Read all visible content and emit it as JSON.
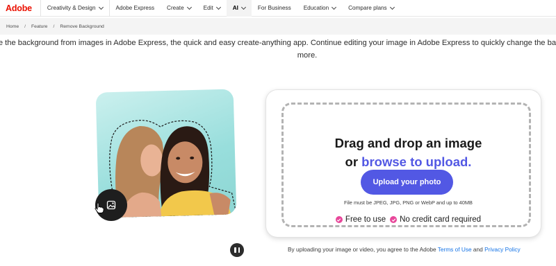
{
  "nav": {
    "brand": "Adobe",
    "items": [
      {
        "label": "Creativity & Design",
        "dropdown": true
      },
      {
        "label": "Adobe Express",
        "dropdown": false
      },
      {
        "label": "Create",
        "dropdown": true
      },
      {
        "label": "Edit",
        "dropdown": true
      },
      {
        "label": "AI",
        "dropdown": true,
        "active": true
      },
      {
        "label": "For Business",
        "dropdown": false
      },
      {
        "label": "Education",
        "dropdown": true
      },
      {
        "label": "Compare plans",
        "dropdown": true
      }
    ]
  },
  "breadcrumb": {
    "items": [
      "Home",
      "Feature",
      "Remove Background"
    ],
    "separator": "/"
  },
  "description": {
    "line1": "ove the background from images in Adobe Express, the quick and easy create-anything app. Continue editing your image in Adobe Express to quickly change the ba",
    "line2": "more."
  },
  "preview": {
    "icon": "image-icon",
    "background_color": "#98dedc"
  },
  "upload": {
    "title_line1": "Drag and drop an image",
    "title_line2_prefix": "or ",
    "browse_link": "browse to upload.",
    "button_label": "Upload your photo",
    "file_note": "File must be JPEG, JPG, PNG or WebP and up to 40MB",
    "features": [
      "Free to use",
      "No credit card required"
    ],
    "accent_color": "#5258e4",
    "check_color": "#e8479a"
  },
  "footer": {
    "terms_prefix": "By uploading your image or video, you agree to the Adobe ",
    "terms_link": "Terms of Use",
    "and_text": " and ",
    "privacy_link": "Privacy Policy",
    "pause_icon": "pause-icon"
  },
  "colors": {
    "brand": "#eb1000",
    "link": "#1473e6"
  }
}
